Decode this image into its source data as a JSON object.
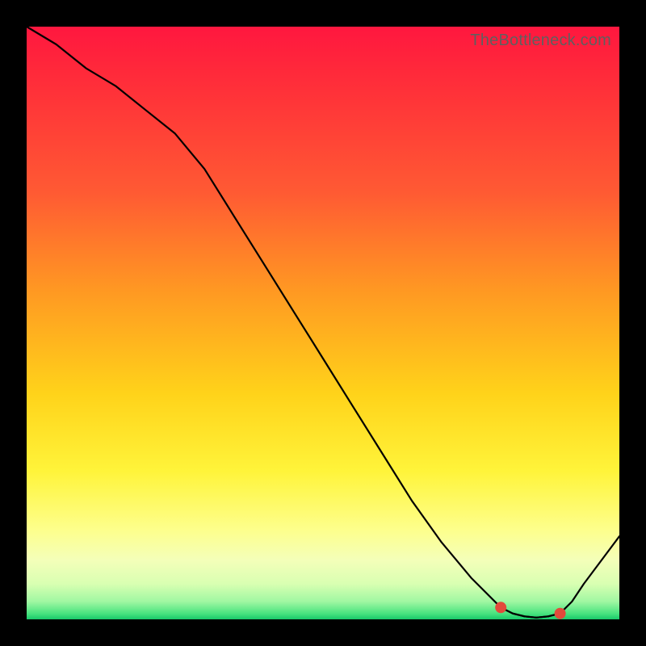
{
  "attribution": "TheBottleneck.com",
  "chart_data": {
    "type": "line",
    "title": "",
    "xlabel": "",
    "ylabel": "",
    "xlim": [
      0,
      100
    ],
    "ylim": [
      0,
      100
    ],
    "series": [
      {
        "name": "curve",
        "x": [
          0,
          5,
          10,
          15,
          20,
          25,
          30,
          35,
          40,
          45,
          50,
          55,
          60,
          65,
          70,
          75,
          80,
          82,
          84,
          86,
          88,
          90,
          92,
          94,
          100
        ],
        "values": [
          100,
          97,
          93,
          90,
          86,
          82,
          76,
          68,
          60,
          52,
          44,
          36,
          28,
          20,
          13,
          7,
          2,
          1,
          0.5,
          0.3,
          0.5,
          1,
          3,
          6,
          14
        ]
      }
    ],
    "markers": {
      "name": "highlighted-range",
      "x": [
        80,
        82,
        84,
        86,
        88,
        90
      ],
      "values": [
        2,
        1,
        0.5,
        0.3,
        0.5,
        1
      ]
    },
    "gradient_stops": [
      {
        "pos": 0.0,
        "color": "#ff173f"
      },
      {
        "pos": 0.28,
        "color": "#ff5a33"
      },
      {
        "pos": 0.62,
        "color": "#ffd31a"
      },
      {
        "pos": 0.85,
        "color": "#fdff8d"
      },
      {
        "pos": 0.97,
        "color": "#a0f7a2"
      },
      {
        "pos": 1.0,
        "color": "#18c96a"
      }
    ]
  }
}
